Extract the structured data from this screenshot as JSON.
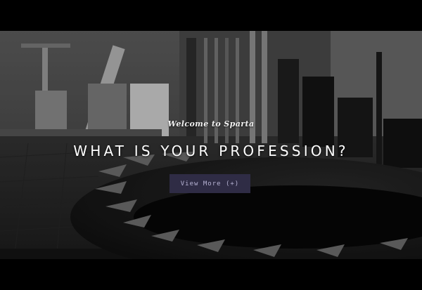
{
  "hero": {
    "background": "gym-floor-tire-photo",
    "tagline": "Welcome to Sparta",
    "headline": "WHAT IS YOUR PROFESSION?",
    "cta_label": "View More (+)",
    "cta_color": "#2f2c45"
  }
}
